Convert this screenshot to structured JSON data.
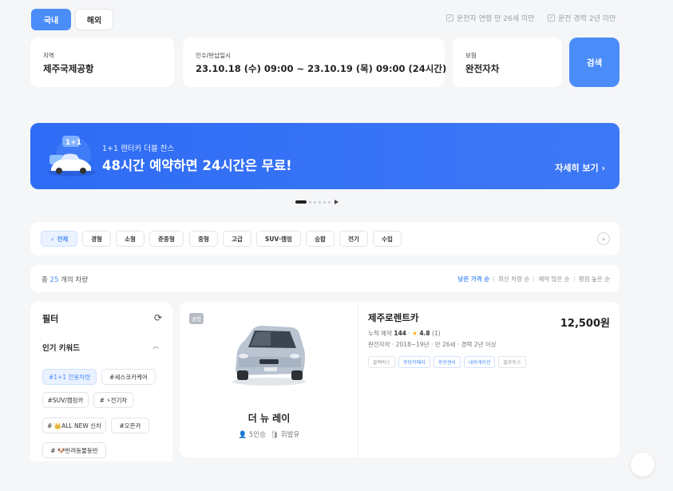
{
  "region_tabs": {
    "domestic": "국내",
    "overseas": "해외"
  },
  "conditions": {
    "age": "운전자 연령 만 26세 미만",
    "experience": "운전 경력 2년 미만",
    "check_icon": "checkbox-icon"
  },
  "search": {
    "location_label": "지역",
    "location_value": "제주국제공항",
    "dates_label": "인수/반납일시",
    "dates_value": "23.10.18 (수) 09:00 ~ 23.10.19 (목) 09:00 (24시간)",
    "insurance_label": "보험",
    "insurance_value": "완전자차",
    "button": "검색"
  },
  "banner": {
    "subtitle": "1+1 렌터카 더블 찬스",
    "title": "48시간 예약하면 24시간은 무료!",
    "more": "자세히 보기 ›",
    "colors": {
      "start": "#2f6cf5",
      "end": "#3d78f6"
    }
  },
  "categories": [
    {
      "label": "✓ 전체",
      "active": true
    },
    {
      "label": "경형"
    },
    {
      "label": "소형"
    },
    {
      "label": "준중형"
    },
    {
      "label": "중형"
    },
    {
      "label": "고급"
    },
    {
      "label": "SUV·캠핑"
    },
    {
      "label": "승합"
    },
    {
      "label": "전기"
    },
    {
      "label": "수입"
    }
  ],
  "summary": {
    "prefix": "총 ",
    "count": "25",
    "suffix": " 개의 차량",
    "sorts": [
      "낮은 가격 순",
      "최신 차량 순",
      "예약 많은 순",
      "평점 높은 순"
    ]
  },
  "filter": {
    "title": "필터",
    "keywords_title": "인기 키워드",
    "tags": [
      "#1+1 전용차량",
      "#세스코카케어",
      "#SUV/캠핑카",
      "# ⚡전기차",
      "# 👑ALL NEW 신차",
      "#오픈카",
      "# 🐶반려동물동반"
    ]
  },
  "car": {
    "grade": "경형",
    "name": "더 뉴 레이",
    "seats": "5인승",
    "fuel": "휘발유",
    "company": "제주로렌트카",
    "price": "12,500원",
    "reservations_label": "누적 예약",
    "reservations": "144",
    "rating": "4.8",
    "reviews": "(1)",
    "info": "완전자차 · 2018~19년 · 만 26세 · 경력 2년 이상",
    "options": [
      "블랙박스",
      "후방카메라",
      "후방센서",
      "내비게이션",
      "블루투스"
    ]
  },
  "accent": "#4b8df8"
}
